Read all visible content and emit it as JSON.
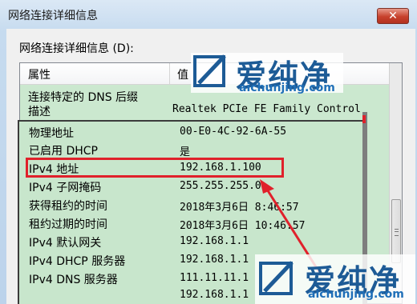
{
  "window": {
    "title": "网络连接详细信息",
    "close_glyph": "✕"
  },
  "details_label": "网络连接详细信息 (D):",
  "columns": {
    "property": "属性",
    "value": "值"
  },
  "list_rows": [
    {
      "property": "连接特定的 DNS 后缀",
      "value": ""
    },
    {
      "property": "描述",
      "value": "Realtek PCIe FE Family Control"
    }
  ],
  "popup_rows": [
    {
      "property": "物理地址",
      "value": "00-E0-4C-92-6A-55"
    },
    {
      "property": "已启用 DHCP",
      "value": "是"
    },
    {
      "property": "IPv4 地址",
      "value": "192.168.1.100"
    },
    {
      "property": "IPv4 子网掩码",
      "value": "255.255.255.0"
    },
    {
      "property": "获得租约的时间",
      "value": "2018年3月6日 8:46:57"
    },
    {
      "property": "租约过期的时间",
      "value": "2018年3月6日 10:46:57"
    },
    {
      "property": "IPv4 默认网关",
      "value": "192.168.1.1"
    },
    {
      "property": "IPv4 DHCP 服务器",
      "value": "192.168.1.1"
    },
    {
      "property": "IPv4 DNS 服务器",
      "value": "111.11.11.1"
    },
    {
      "property": "",
      "value": "192.168.1.1"
    }
  ],
  "watermark": {
    "name": "爱纯净",
    "url": "aichunjing.com"
  },
  "colors": {
    "highlight": "#e0212b",
    "row_bg": "#c8e6cc",
    "watermark": "#1d5b96"
  }
}
